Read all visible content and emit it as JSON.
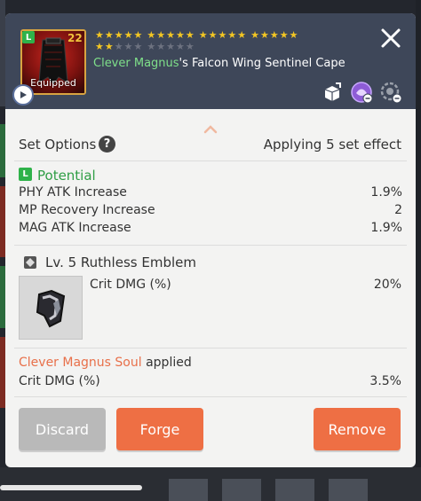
{
  "header": {
    "grade_letter": "L",
    "level": "22",
    "equipped_label": "Equipped",
    "stars_rows": [
      {
        "gold": 20,
        "grey": 0
      },
      {
        "gold": 2,
        "grey": 8
      }
    ],
    "owner_name": "Clever Magnus",
    "item_name_suffix": "'s Falcon Wing Sentinel Cape",
    "icons": [
      "share-icon",
      "awaken-icon",
      "lock-settings-icon"
    ]
  },
  "set_options": {
    "label": "Set Options",
    "help": "?",
    "effect": "Applying 5 set effect"
  },
  "potential": {
    "grade_letter": "L",
    "title": "Potential",
    "stats": [
      {
        "name": "PHY ATK Increase",
        "value": "1.9%"
      },
      {
        "name": "MP Recovery Increase",
        "value": "2"
      },
      {
        "name": "MAG ATK Increase",
        "value": "1.9%"
      }
    ]
  },
  "emblem": {
    "title": "Lv. 5 Ruthless Emblem",
    "stat_name": "Crit DMG (%)",
    "stat_value": "20%"
  },
  "soul": {
    "name": "Clever Magnus Soul",
    "suffix": " applied",
    "stat_name": "Crit DMG (%)",
    "stat_value": "3.5%"
  },
  "buttons": {
    "discard": "Discard",
    "forge": "Forge",
    "remove": "Remove"
  },
  "colors": {
    "header_bg": "#3e4759",
    "owner_green": "#7fe08a",
    "potential_green": "#2f9e45",
    "soul_orange": "#e8704a",
    "button_orange": "#ee6f44",
    "button_grey": "#b9b9b9"
  }
}
